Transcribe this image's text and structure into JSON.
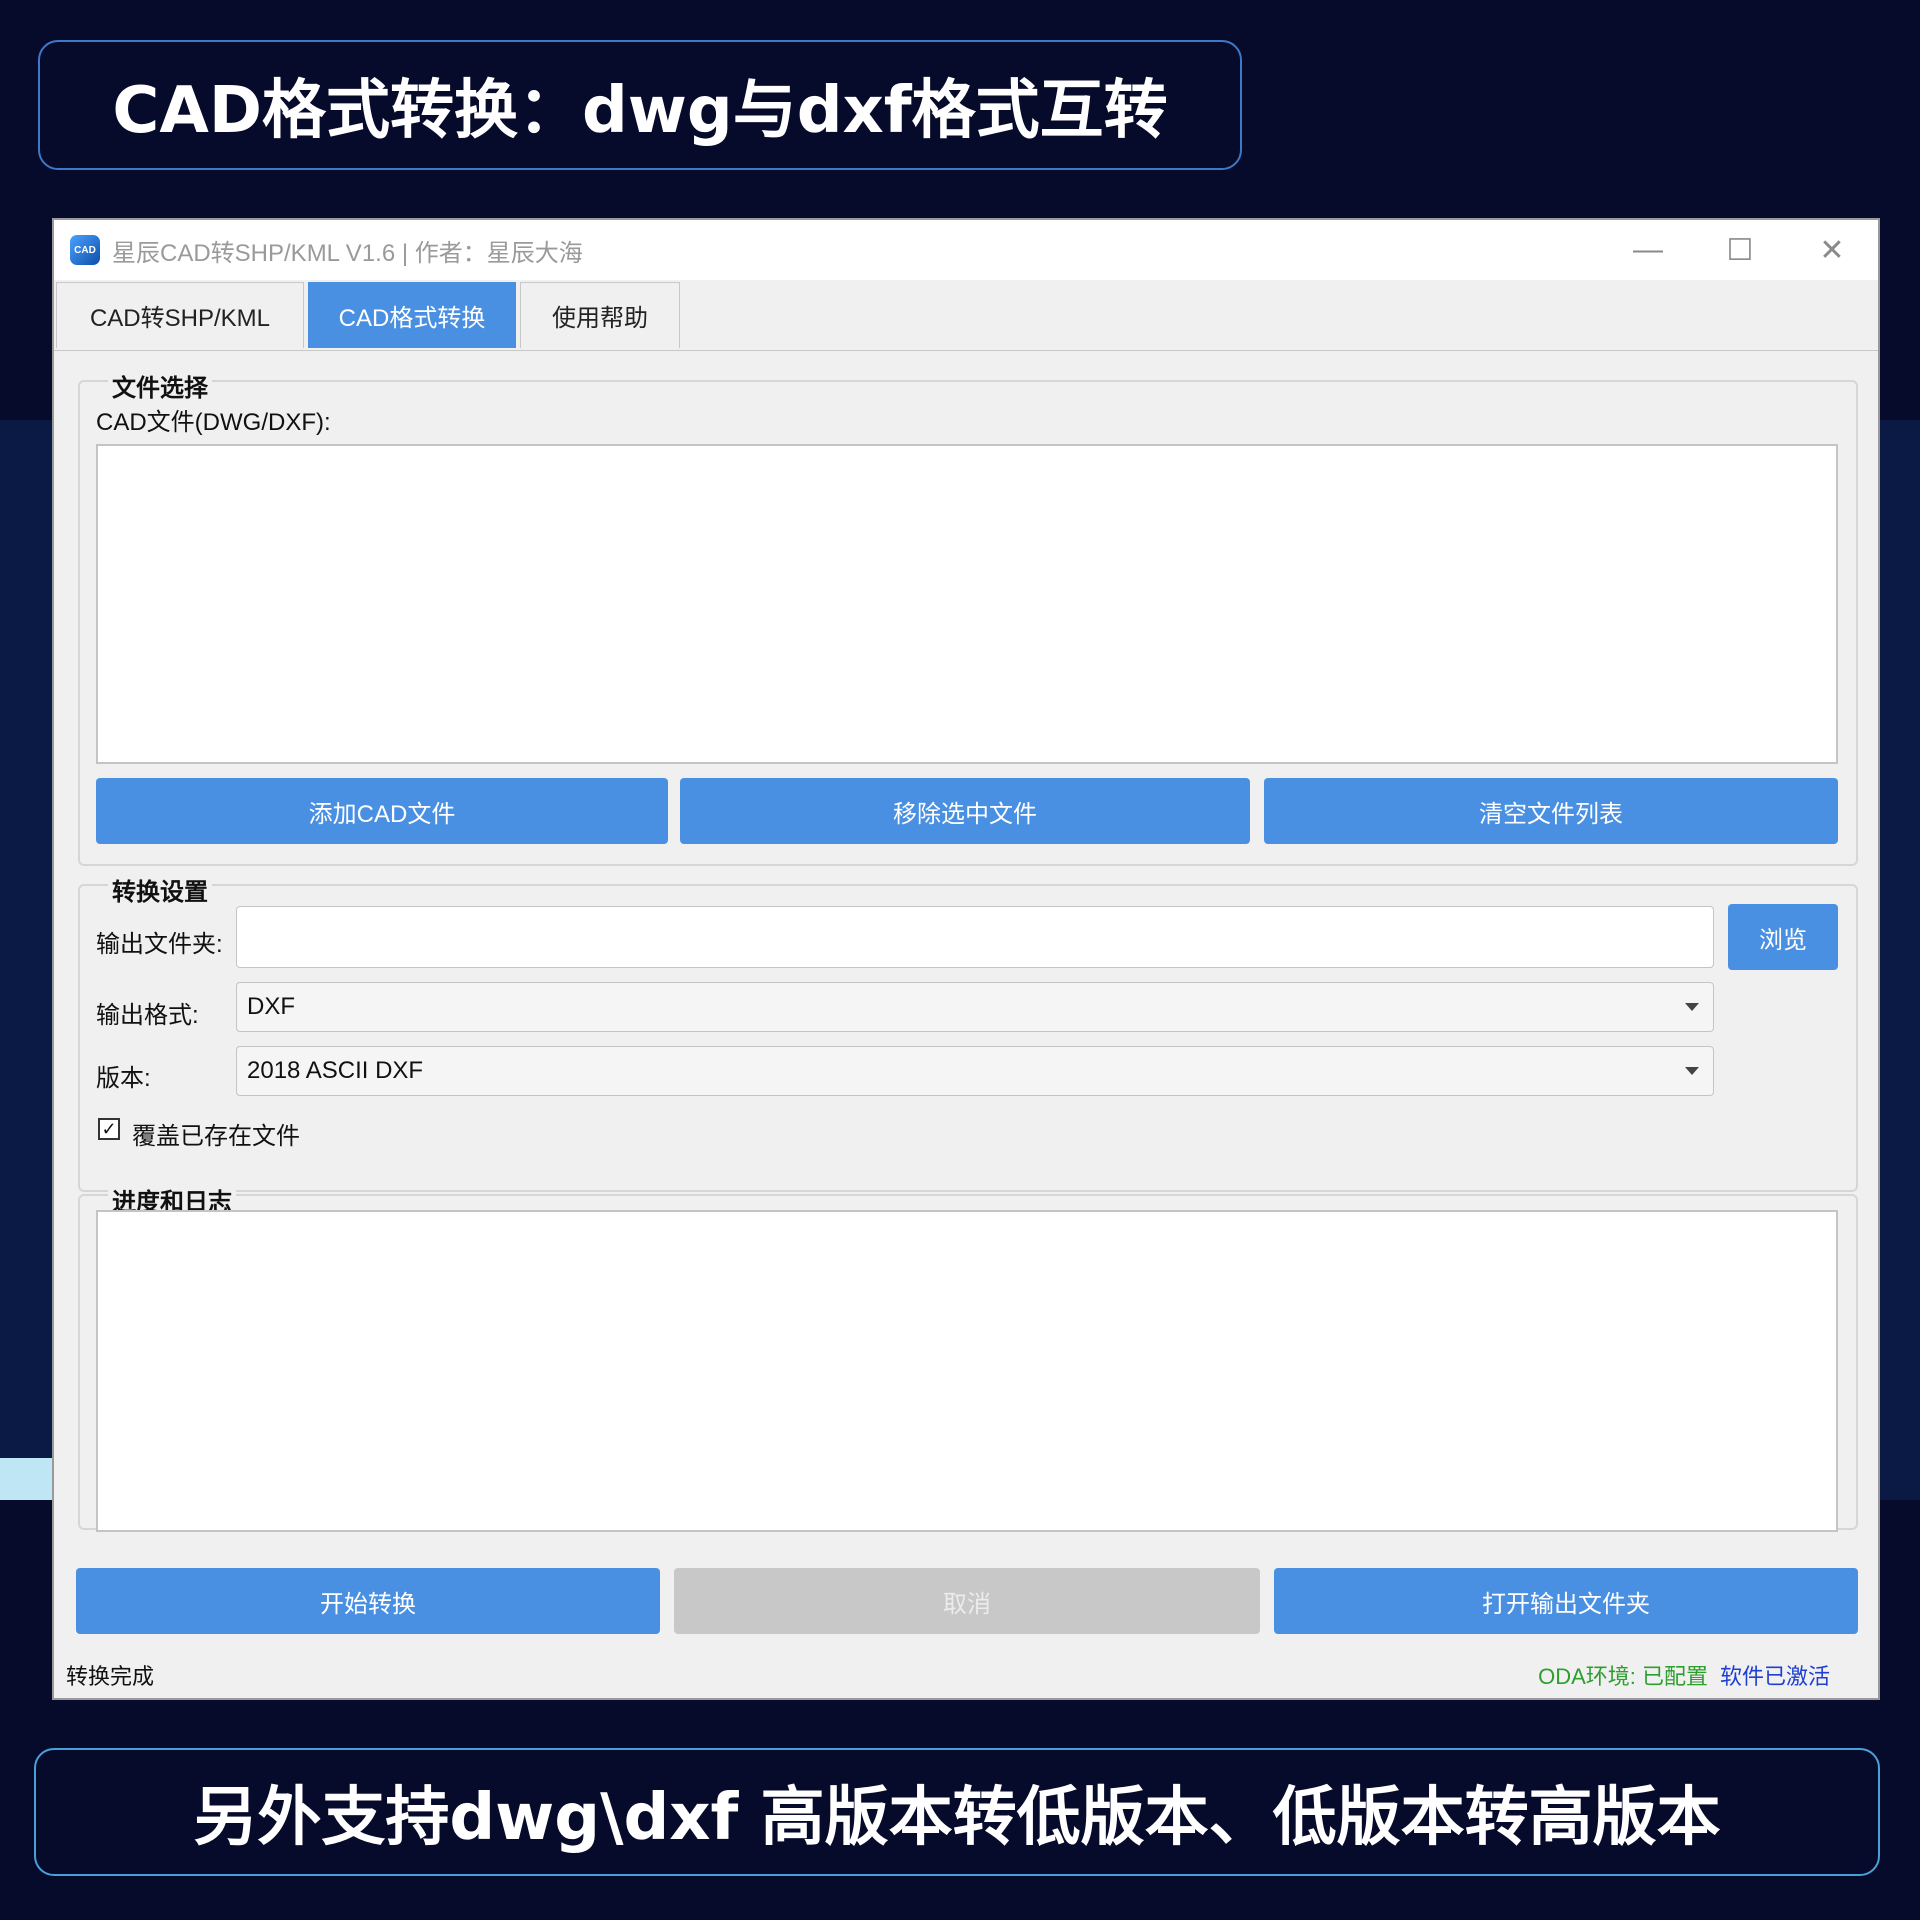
{
  "banner_top": "CAD格式转换：dwg与dxf格式互转",
  "banner_bottom": "另外支持dwg\\dxf 高版本转低版本、低版本转高版本",
  "window": {
    "title": "星辰CAD转SHP/KML V1.6 | 作者：星辰大海",
    "icon_label": "CAD",
    "controls": {
      "minimize": "—",
      "maximize": "☐",
      "close": "✕"
    }
  },
  "tabs": [
    {
      "label": "CAD转SHP/KML",
      "active": false
    },
    {
      "label": "CAD格式转换",
      "active": true
    },
    {
      "label": "使用帮助",
      "active": false
    }
  ],
  "file_section": {
    "title": "文件选择",
    "list_label": "CAD文件(DWG/DXF):",
    "buttons": {
      "add": "添加CAD文件",
      "remove": "移除选中文件",
      "clear": "清空文件列表"
    }
  },
  "settings_section": {
    "title": "转换设置",
    "output_folder_label": "输出文件夹:",
    "output_folder_value": "",
    "browse_button": "浏览",
    "format_label": "输出格式:",
    "format_value": "DXF",
    "version_label": "版本:",
    "version_value": "2018 ASCII DXF",
    "overwrite_label": "覆盖已存在文件",
    "overwrite_checked": true,
    "check_mark": "✓"
  },
  "log_section": {
    "title": "进度和日志"
  },
  "actions": {
    "start": "开始转换",
    "cancel": "取消",
    "open_output": "打开输出文件夹"
  },
  "status": {
    "left": "转换完成",
    "oda": "ODA环境: 已配置",
    "activation": "软件已激活",
    "colors": {
      "oda": "#2e9e2e",
      "activation": "#1f3fd1"
    }
  },
  "colors": {
    "accent": "#4a90e2",
    "background": "#060a2b"
  }
}
